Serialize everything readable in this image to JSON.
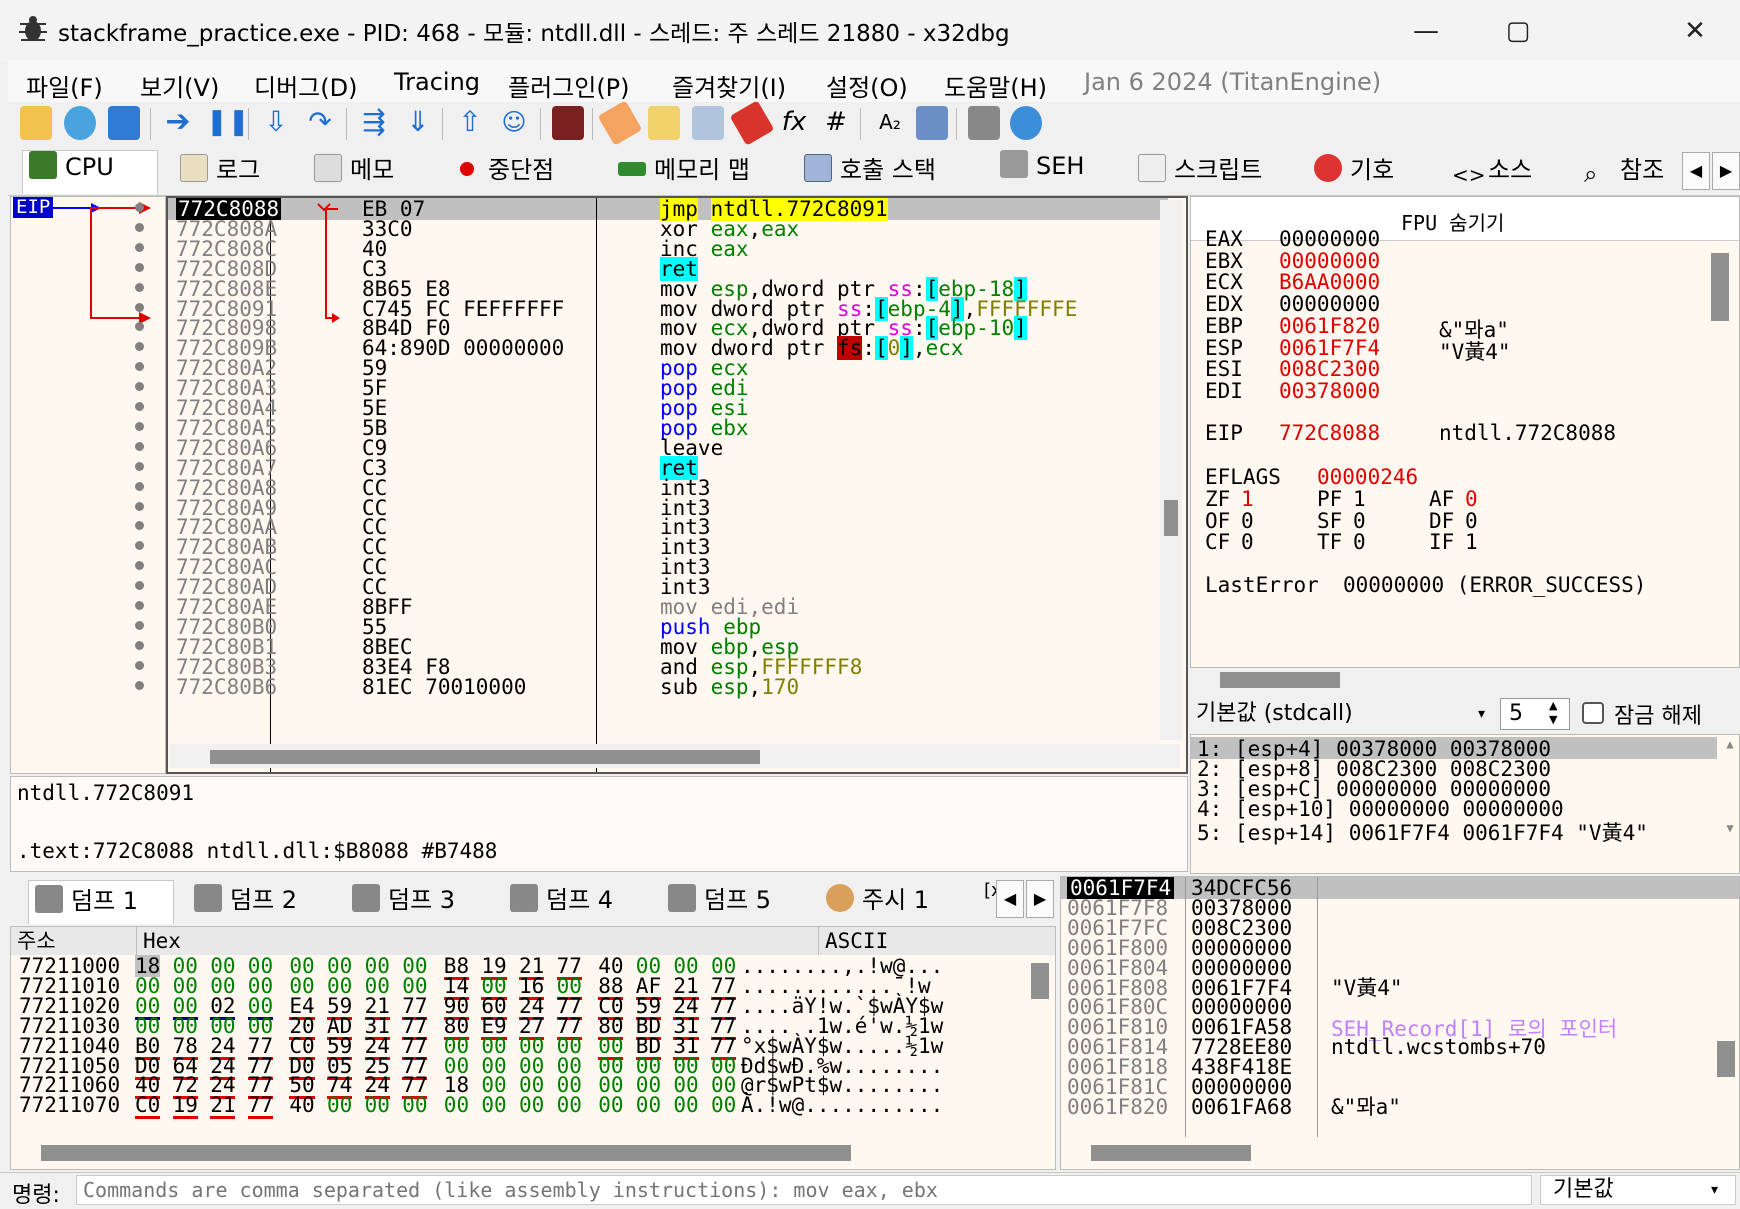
{
  "window": {
    "title": "stackframe_practice.exe - PID: 468 - 모듈: ntdll.dll - 스레드: 주 스레드 21880 - x32dbg"
  },
  "menu": [
    "파일(F)",
    "보기(V)",
    "디버그(D)",
    "Tracing",
    "플러그인(P)",
    "즐겨찾기(I)",
    "설정(O)",
    "도움말(H)",
    "Jan 6 2024 (TitanEngine)"
  ],
  "tabs": [
    "CPU",
    "로그",
    "메모",
    "중단점",
    "메모리 맵",
    "호출 스택",
    "SEH",
    "스크립트",
    "기호",
    "소스",
    "참조"
  ],
  "eip_label": "EIP",
  "disasm": [
    {
      "addr": "772C8088",
      "bytes": "EB 07",
      "mn": "jmp",
      "ops": "ntdll.772C8091"
    },
    {
      "addr": "772C808A",
      "bytes": "33C0",
      "mn": "xor",
      "ops": "eax,eax"
    },
    {
      "addr": "772C808C",
      "bytes": "40",
      "mn": "inc",
      "ops": "eax"
    },
    {
      "addr": "772C808D",
      "bytes": "C3",
      "mn": "ret",
      "ops": ""
    },
    {
      "addr": "772C808E",
      "bytes": "8B65 E8",
      "mn": "mov",
      "ops": "esp,dword ptr ss:[ebp-18]"
    },
    {
      "addr": "772C8091",
      "bytes": "C745 FC FEFFFFFF",
      "mn": "mov",
      "ops": "dword ptr ss:[ebp-4],FFFFFFFE"
    },
    {
      "addr": "772C8098",
      "bytes": "8B4D F0",
      "mn": "mov",
      "ops": "ecx,dword ptr ss:[ebp-10]"
    },
    {
      "addr": "772C809B",
      "bytes": "64:890D 00000000",
      "mn": "mov",
      "ops": "dword ptr fs:[0],ecx"
    },
    {
      "addr": "772C80A2",
      "bytes": "59",
      "mn": "pop",
      "ops": "ecx"
    },
    {
      "addr": "772C80A3",
      "bytes": "5F",
      "mn": "pop",
      "ops": "edi"
    },
    {
      "addr": "772C80A4",
      "bytes": "5E",
      "mn": "pop",
      "ops": "esi"
    },
    {
      "addr": "772C80A5",
      "bytes": "5B",
      "mn": "pop",
      "ops": "ebx"
    },
    {
      "addr": "772C80A6",
      "bytes": "C9",
      "mn": "leave",
      "ops": ""
    },
    {
      "addr": "772C80A7",
      "bytes": "C3",
      "mn": "ret",
      "ops": ""
    },
    {
      "addr": "772C80A8",
      "bytes": "CC",
      "mn": "int3",
      "ops": ""
    },
    {
      "addr": "772C80A9",
      "bytes": "CC",
      "mn": "int3",
      "ops": ""
    },
    {
      "addr": "772C80AA",
      "bytes": "CC",
      "mn": "int3",
      "ops": ""
    },
    {
      "addr": "772C80AB",
      "bytes": "CC",
      "mn": "int3",
      "ops": ""
    },
    {
      "addr": "772C80AC",
      "bytes": "CC",
      "mn": "int3",
      "ops": ""
    },
    {
      "addr": "772C80AD",
      "bytes": "CC",
      "mn": "int3",
      "ops": ""
    },
    {
      "addr": "772C80AE",
      "bytes": "8BFF",
      "mn": "mov",
      "ops": "edi,edi"
    },
    {
      "addr": "772C80B0",
      "bytes": "55",
      "mn": "push",
      "ops": "ebp"
    },
    {
      "addr": "772C80B1",
      "bytes": "8BEC",
      "mn": "mov",
      "ops": "ebp,esp"
    },
    {
      "addr": "772C80B3",
      "bytes": "83E4 F8",
      "mn": "and",
      "ops": "esp,FFFFFFF8"
    },
    {
      "addr": "772C80B6",
      "bytes": "81EC 70010000",
      "mn": "sub",
      "ops": "esp,170"
    }
  ],
  "info": {
    "line1": "ntdll.772C8091",
    "line2": ".text:772C8088 ntdll.dll:$B8088 #B7488"
  },
  "fpu_label": "FPU 숨기기",
  "registers": [
    {
      "name": "EAX",
      "value": "00000000",
      "changed": false,
      "comment": ""
    },
    {
      "name": "EBX",
      "value": "00000000",
      "changed": true,
      "comment": ""
    },
    {
      "name": "ECX",
      "value": "B6AA0000",
      "changed": true,
      "comment": ""
    },
    {
      "name": "EDX",
      "value": "00000000",
      "changed": false,
      "comment": ""
    },
    {
      "name": "EBP",
      "value": "0061F820",
      "changed": true,
      "comment": "&\"뫄a\""
    },
    {
      "name": "ESP",
      "value": "0061F7F4",
      "changed": true,
      "comment": "\"V黃4\""
    },
    {
      "name": "ESI",
      "value": "008C2300",
      "changed": true,
      "comment": ""
    },
    {
      "name": "EDI",
      "value": "00378000",
      "changed": true,
      "comment": ""
    }
  ],
  "eip_reg": {
    "name": "EIP",
    "value": "772C8088",
    "comment": "ntdll.772C8088"
  },
  "eflags": {
    "name": "EFLAGS",
    "value": "00000246"
  },
  "flags": [
    [
      {
        "n": "ZF",
        "v": "1",
        "c": true
      },
      {
        "n": "PF",
        "v": "1",
        "c": false
      },
      {
        "n": "AF",
        "v": "0",
        "c": true
      }
    ],
    [
      {
        "n": "OF",
        "v": "0",
        "c": false
      },
      {
        "n": "SF",
        "v": "0",
        "c": false
      },
      {
        "n": "DF",
        "v": "0",
        "c": false
      }
    ],
    [
      {
        "n": "CF",
        "v": "0",
        "c": false
      },
      {
        "n": "TF",
        "v": "0",
        "c": false
      },
      {
        "n": "IF",
        "v": "1",
        "c": false
      }
    ]
  ],
  "lasterror": {
    "name": "LastError",
    "value": "00000000 (ERROR_SUCCESS)"
  },
  "callconv": {
    "value": "기본값 (stdcall)",
    "count": "5",
    "lock_label": "잠금 해제"
  },
  "stack_args": [
    "1: [esp+4] 00378000 00378000",
    "2: [esp+8] 008C2300 008C2300",
    "3: [esp+C] 00000000 00000000",
    "4: [esp+10] 00000000 00000000",
    "5: [esp+14] 0061F7F4 0061F7F4 \"V黃4\""
  ],
  "dump_tabs": [
    "덤프 1",
    "덤프 2",
    "덤프 3",
    "덤프 4",
    "덤프 5",
    "주시 1",
    "[x="
  ],
  "dump_headers": {
    "addr": "주소",
    "hex": "Hex",
    "ascii": "ASCII"
  },
  "dump_rows": [
    {
      "addr": "77211000",
      "hex": [
        "18",
        "00",
        "00",
        "00",
        "00",
        "00",
        "00",
        "00",
        "B8",
        "19",
        "21",
        "77",
        "40",
        "00",
        "00",
        "00"
      ],
      "ascii": "........,.!w@..."
    },
    {
      "addr": "77211010",
      "hex": [
        "00",
        "00",
        "00",
        "00",
        "00",
        "00",
        "00",
        "00",
        "14",
        "00",
        "16",
        "00",
        "88",
        "AF",
        "21",
        "77"
      ],
      "ascii": "............¯!w"
    },
    {
      "addr": "77211020",
      "hex": [
        "00",
        "00",
        "02",
        "00",
        "E4",
        "59",
        "21",
        "77",
        "90",
        "60",
        "24",
        "77",
        "C0",
        "59",
        "24",
        "77"
      ],
      "ascii": "....äY!w.`$wÀY$w"
    },
    {
      "addr": "77211030",
      "hex": [
        "00",
        "00",
        "00",
        "00",
        "20",
        "AD",
        "31",
        "77",
        "80",
        "E9",
        "27",
        "77",
        "80",
        "BD",
        "31",
        "77"
      ],
      "ascii": ".... .1w.é'w.½1w"
    },
    {
      "addr": "77211040",
      "hex": [
        "B0",
        "78",
        "24",
        "77",
        "C0",
        "59",
        "24",
        "77",
        "00",
        "00",
        "00",
        "00",
        "00",
        "BD",
        "31",
        "77"
      ],
      "ascii": "°x$wÀY$w.....½1w"
    },
    {
      "addr": "77211050",
      "hex": [
        "D0",
        "64",
        "24",
        "77",
        "D0",
        "05",
        "25",
        "77",
        "00",
        "00",
        "00",
        "00",
        "00",
        "00",
        "00",
        "00"
      ],
      "ascii": "Ðd$wÐ.%w........"
    },
    {
      "addr": "77211060",
      "hex": [
        "40",
        "72",
        "24",
        "77",
        "50",
        "74",
        "24",
        "77",
        "18",
        "00",
        "00",
        "00",
        "00",
        "00",
        "00",
        "00"
      ],
      "ascii": "@r$wPt$w........"
    },
    {
      "addr": "77211070",
      "hex": [
        "C0",
        "19",
        "21",
        "77",
        "40",
        "00",
        "00",
        "00",
        "00",
        "00",
        "00",
        "00",
        "00",
        "00",
        "00",
        "00"
      ],
      "ascii": "À.!w@..........."
    }
  ],
  "stack": [
    {
      "addr": "0061F7F4",
      "val": "34DCFC56",
      "comment": ""
    },
    {
      "addr": "0061F7F8",
      "val": "00378000",
      "comment": ""
    },
    {
      "addr": "0061F7FC",
      "val": "008C2300",
      "comment": ""
    },
    {
      "addr": "0061F800",
      "val": "00000000",
      "comment": ""
    },
    {
      "addr": "0061F804",
      "val": "00000000",
      "comment": ""
    },
    {
      "addr": "0061F808",
      "val": "0061F7F4",
      "comment": "\"V黃4\""
    },
    {
      "addr": "0061F80C",
      "val": "00000000",
      "comment": ""
    },
    {
      "addr": "0061F810",
      "val": "0061FA58",
      "comment": "SEH_Record[1] 로의 포인터"
    },
    {
      "addr": "0061F814",
      "val": "7728EE80",
      "comment": "ntdll.wcstombs+70"
    },
    {
      "addr": "0061F818",
      "val": "438F418E",
      "comment": ""
    },
    {
      "addr": "0061F81C",
      "val": "00000000",
      "comment": ""
    },
    {
      "addr": "0061F820",
      "val": "0061FA68",
      "comment": "&\"뫄a\""
    }
  ],
  "command": {
    "label": "명령:",
    "placeholder": "Commands are comma separated (like assembly instructions): mov eax, ebx",
    "mode": "기본값"
  },
  "colors": {
    "accent_red": "#e00000",
    "highlight_yellow": "#ffff00",
    "highlight_cyan": "#00ffff",
    "bg_pane": "#fff8f0"
  }
}
